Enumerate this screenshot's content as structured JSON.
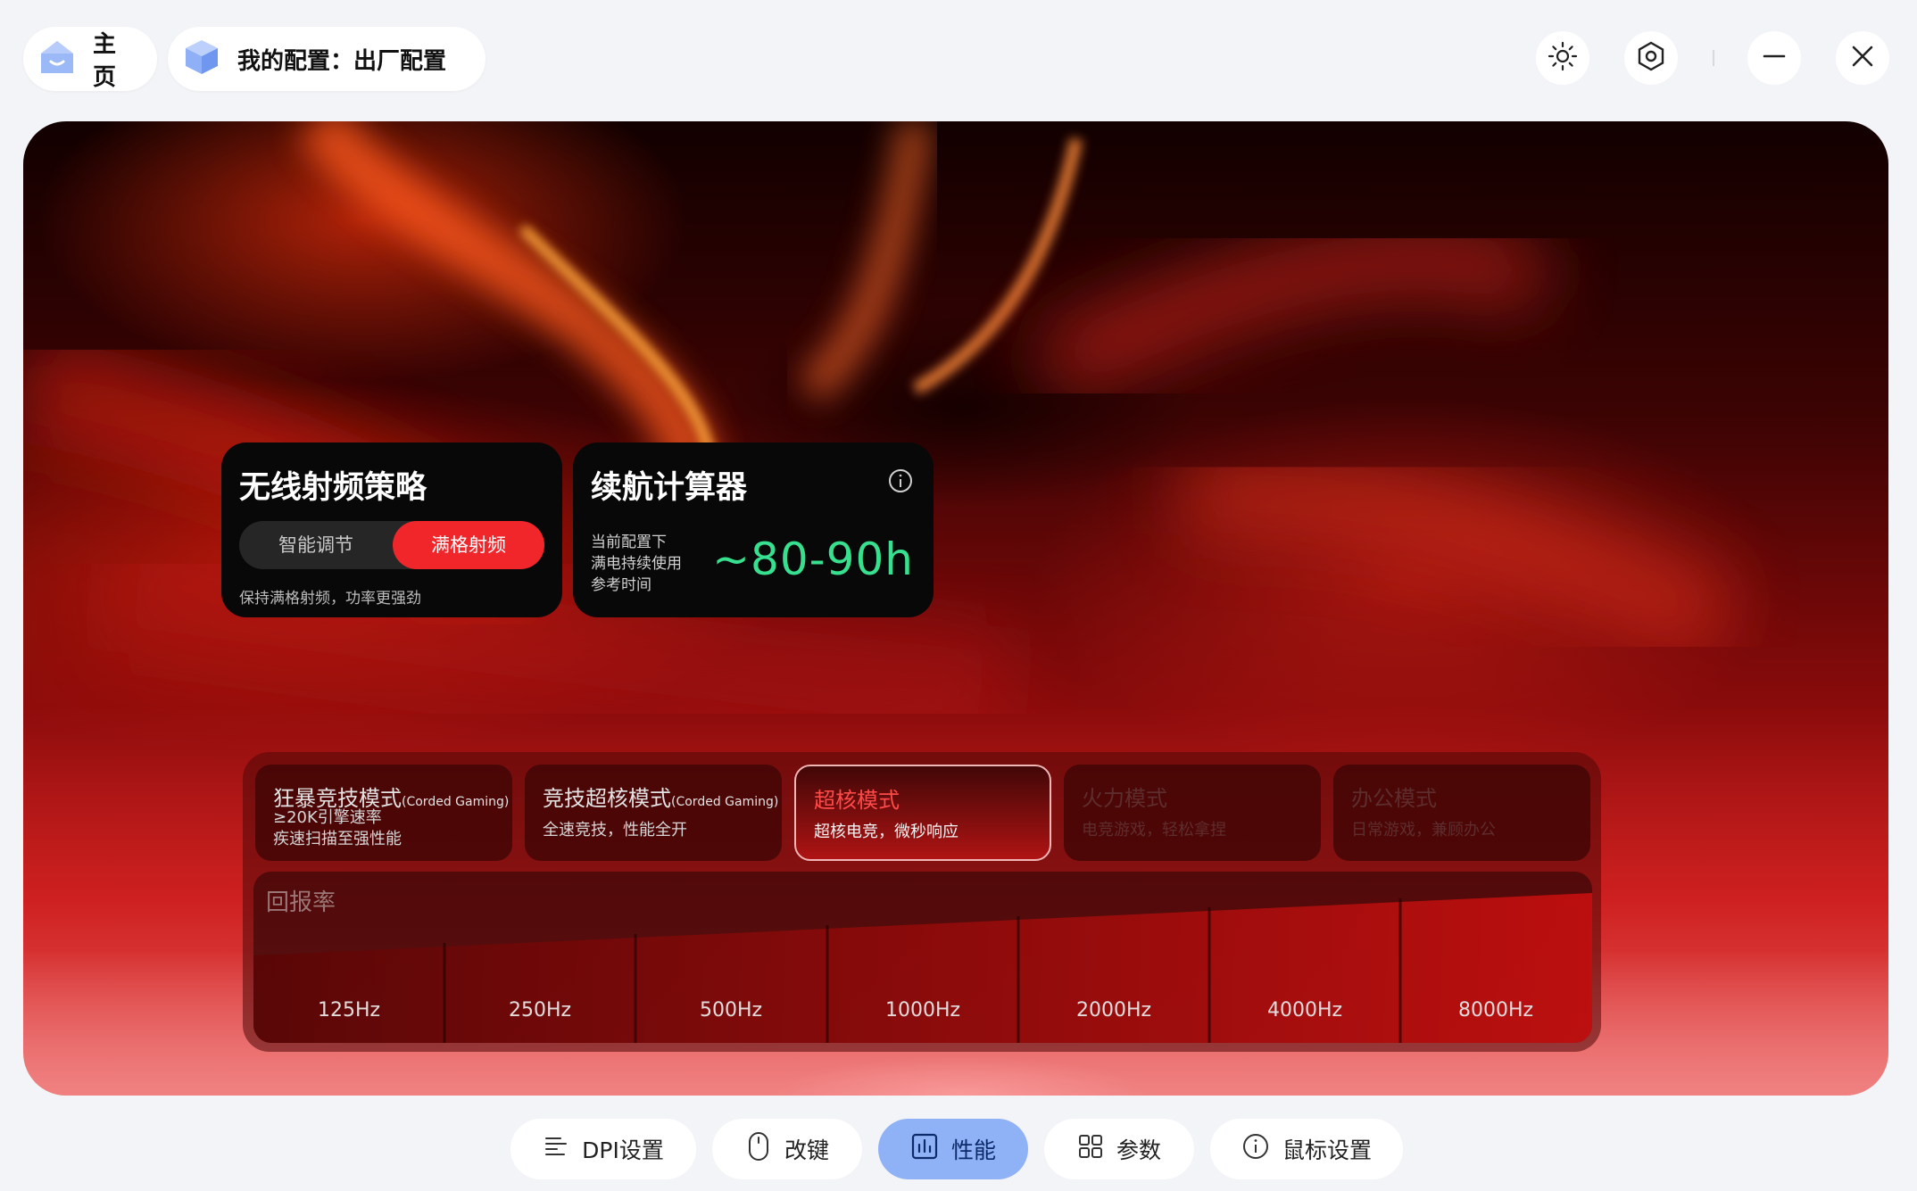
{
  "topbar": {
    "home_label": "主页",
    "config_label": "我的配置：出厂配置"
  },
  "colors": {
    "accent_red": "#f1262a",
    "battery_green": "#37e08f",
    "nav_active": "#8fb1f6",
    "home_icon": "#9bb8f7"
  },
  "rf_card": {
    "title": "无线射频策略",
    "option_off": "智能调节",
    "option_on": "满格射频",
    "selected": "满格射频",
    "description": "保持满格射频，功率更强劲"
  },
  "battery_card": {
    "title": "续航计算器",
    "line1": "当前配置下",
    "line2": "满电持续使用",
    "line3": "参考时间",
    "value": "~80-90h"
  },
  "modes": [
    {
      "name": "狂暴竞技模式",
      "tag": "(Corded Gaming)",
      "desc1": "≥20K引擎速率",
      "desc2": "疾速扫描至强性能",
      "state": "normal"
    },
    {
      "name": "竞技超核模式",
      "tag": "(Corded Gaming)",
      "desc1": "全速竞技，性能全开",
      "desc2": "",
      "state": "normal"
    },
    {
      "name": "超核模式",
      "tag": "",
      "desc1": "超核电竞，微秒响应",
      "desc2": "",
      "state": "active"
    },
    {
      "name": "火力模式",
      "tag": "",
      "desc1": "电竞游戏，轻松拿捏",
      "desc2": "",
      "state": "disabled"
    },
    {
      "name": "办公模式",
      "tag": "",
      "desc1": "日常游戏，兼顾办公",
      "desc2": "",
      "state": "disabled"
    }
  ],
  "polling": {
    "title": "回报率",
    "rates": [
      "125Hz",
      "250Hz",
      "500Hz",
      "1000Hz",
      "2000Hz",
      "4000Hz",
      "8000Hz"
    ]
  },
  "bottom_nav": [
    {
      "label": "DPI设置",
      "icon": "dpi-icon"
    },
    {
      "label": "改键",
      "icon": "mouse-icon"
    },
    {
      "label": "性能",
      "icon": "performance-icon",
      "active": true
    },
    {
      "label": "参数",
      "icon": "grid-icon"
    },
    {
      "label": "鼠标设置",
      "icon": "info-icon"
    }
  ]
}
